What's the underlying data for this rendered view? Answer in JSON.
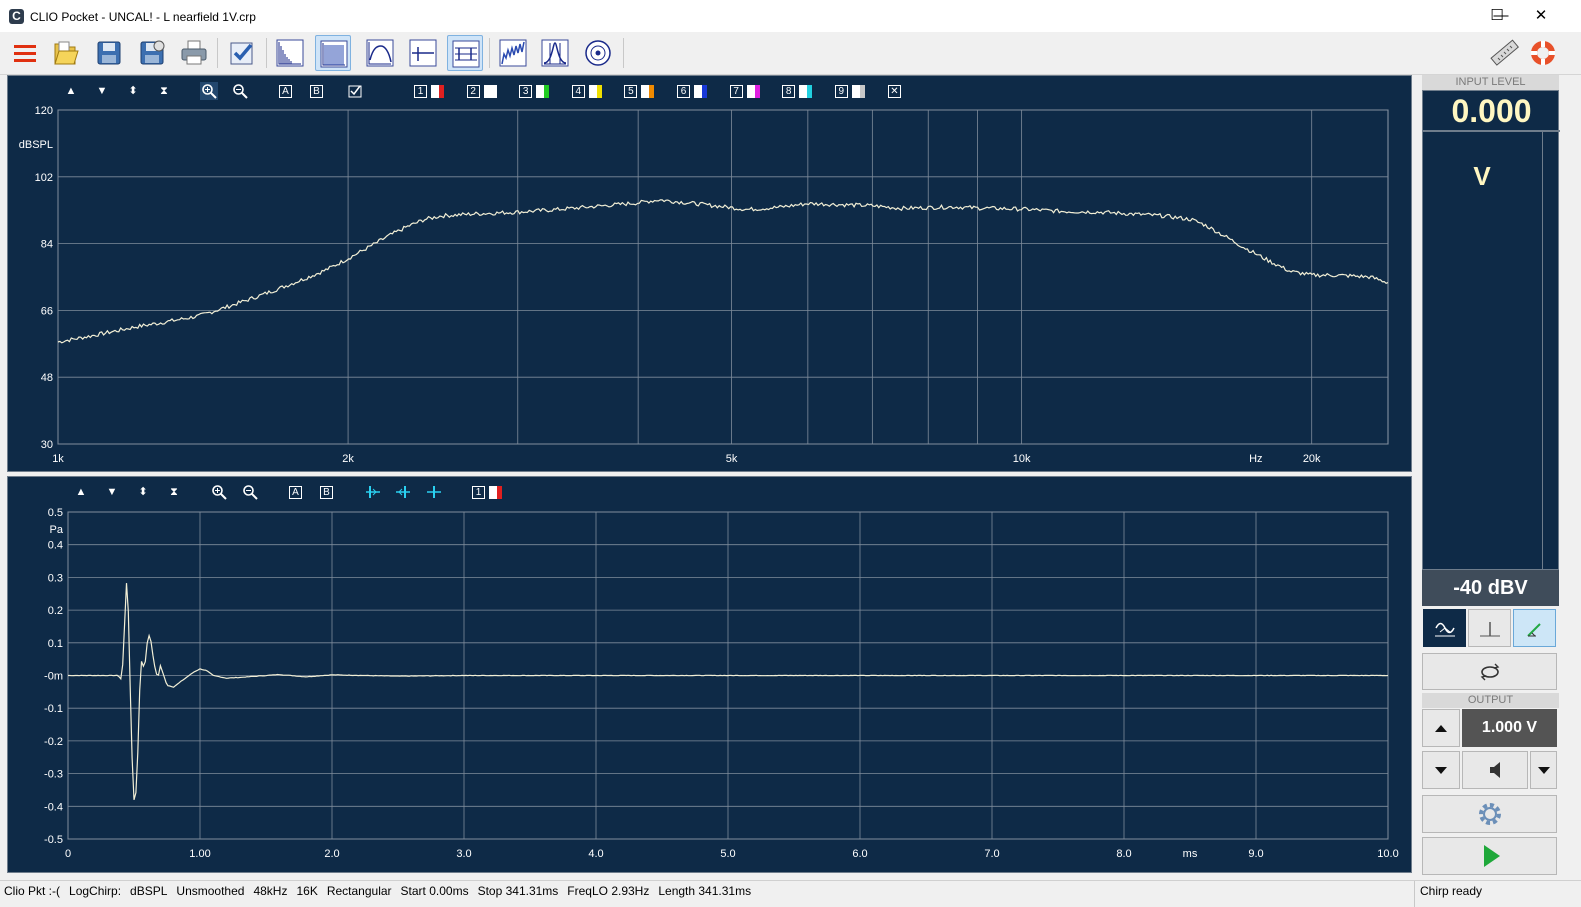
{
  "window": {
    "title": "CLIO Pocket - UNCAL! - L nearfield 1V.crp",
    "logo_letter": "C",
    "minimize": "—",
    "maximize": "☐",
    "close": "✕"
  },
  "toolbar": {
    "buttons": [
      {
        "name": "menu",
        "icon": "hamburger-icon",
        "active": false
      },
      {
        "name": "open",
        "icon": "open-folder-icon",
        "active": false
      },
      {
        "name": "save",
        "icon": "save-icon",
        "active": false
      },
      {
        "name": "save-as",
        "icon": "save-as-icon",
        "active": false
      },
      {
        "name": "print",
        "icon": "printer-icon",
        "active": false
      },
      {
        "name": "calibration",
        "icon": "checkbox-icon",
        "active": false
      },
      {
        "name": "fft",
        "icon": "fft-icon",
        "active": false
      },
      {
        "name": "mls",
        "icon": "mls-icon",
        "active": true
      },
      {
        "name": "sinusoidal",
        "icon": "sinusoidal-icon",
        "active": false
      },
      {
        "name": "waterfall",
        "icon": "waterfall-icon",
        "active": false
      },
      {
        "name": "impulse",
        "icon": "impulse-icon",
        "active": true
      },
      {
        "name": "spectrum",
        "icon": "spectrum-icon",
        "active": false
      },
      {
        "name": "thd",
        "icon": "thd-icon",
        "active": false
      },
      {
        "name": "polar",
        "icon": "polar-icon",
        "active": false
      },
      {
        "name": "ruler",
        "icon": "ruler-icon",
        "active": false
      },
      {
        "name": "help",
        "icon": "lifebuoy-icon",
        "active": false
      }
    ]
  },
  "top_panel": {
    "toolbar": {
      "buttons": [
        "▲",
        "▼",
        "⬍",
        "⧗"
      ],
      "marker_a": "A",
      "marker_b": "B",
      "overlays": [
        {
          "label": "1",
          "color": "#e02020"
        },
        {
          "label": "2",
          "color": "#ffffff"
        },
        {
          "label": "3",
          "color": "#22cc22"
        },
        {
          "label": "4",
          "color": "#f0e000"
        },
        {
          "label": "5",
          "color": "#f08a00"
        },
        {
          "label": "6",
          "color": "#1838d8"
        },
        {
          "label": "7",
          "color": "#e020e0"
        },
        {
          "label": "8",
          "color": "#22d0e0"
        },
        {
          "label": "9",
          "color": "#c8c8c8"
        }
      ],
      "clear": "✕"
    }
  },
  "bottom_panel": {
    "toolbar": {
      "buttons": [
        "▲",
        "▼",
        "⬍",
        "⧗"
      ],
      "marker_a": "A",
      "marker_b": "B",
      "overlays": [
        {
          "label": "1",
          "color": "#e02020"
        }
      ]
    }
  },
  "chart_data": [
    {
      "type": "line",
      "title": "",
      "xscale": "log",
      "xlim": [
        1000,
        24000
      ],
      "ylim": [
        30,
        120
      ],
      "ylabel": "dBSPL",
      "xlabel": "Hz",
      "yticks": [
        30,
        48,
        66,
        84,
        102,
        120
      ],
      "yticklabels": [
        "30",
        "48",
        "66",
        "84",
        "102",
        "120"
      ],
      "xticks": [
        1000,
        2000,
        5000,
        10000,
        20000
      ],
      "xticklabels": [
        "1k",
        "2k",
        "5k",
        "10k",
        "20k"
      ],
      "xgrid": [
        1000,
        2000,
        3000,
        4000,
        5000,
        6000,
        7000,
        8000,
        9000,
        10000,
        20000
      ],
      "xlabel_at": 17500,
      "grid": true,
      "line_color": "#f2efd6",
      "series": [
        {
          "x": [
            1000,
            1100,
            1200,
            1300,
            1400,
            1500,
            1600,
            1700,
            1800,
            1900,
            2000,
            2100,
            2200,
            2300,
            2400,
            2500,
            2700,
            3000,
            3300,
            3600,
            4000,
            4200,
            4500,
            4800,
            5200,
            5600,
            6000,
            6500,
            7000,
            7500,
            8000,
            8500,
            9000,
            10000,
            11000,
            12000,
            13000,
            14000,
            15000,
            15500,
            16000,
            17000,
            18000,
            19000,
            20000,
            21000,
            22000,
            23000,
            24000
          ],
          "y": [
            57.5,
            59.5,
            61.5,
            63,
            64.5,
            67,
            69.5,
            72,
            74.5,
            77,
            80,
            83,
            86,
            88.5,
            90.5,
            91.5,
            92,
            92.5,
            93.2,
            94,
            95,
            95.8,
            95,
            94.2,
            93.2,
            93.8,
            94.8,
            94.5,
            94.2,
            93.5,
            93.7,
            93.9,
            93.6,
            93.3,
            92.7,
            92.5,
            92,
            91.5,
            90.5,
            89,
            87,
            83,
            79.5,
            76.5,
            75.5,
            75.5,
            75.3,
            75,
            73.5
          ]
        }
      ]
    },
    {
      "type": "line",
      "title": "",
      "xlim": [
        0,
        10
      ],
      "ylim": [
        -0.5,
        0.5
      ],
      "ylabel": "Pa",
      "xlabel": "ms",
      "yticks": [
        -0.5,
        -0.4,
        -0.3,
        -0.2,
        -0.1,
        0,
        0.1,
        0.2,
        0.3,
        0.4,
        0.5
      ],
      "yticklabels": [
        "-0.5",
        "-0.4",
        "-0.3",
        "-0.2",
        "-0.1",
        "-0m",
        "0.1",
        "0.2",
        "0.3",
        "0.4",
        "0.5"
      ],
      "xticks": [
        0,
        1,
        2,
        3,
        4,
        5,
        6,
        7,
        8,
        9,
        10
      ],
      "xticklabels": [
        "0",
        "1.00",
        "2.0",
        "3.0",
        "4.0",
        "5.0",
        "6.0",
        "7.0",
        "8.0",
        "9.0",
        "10.0"
      ],
      "xlabel_at": 8.5,
      "grid": true,
      "line_color": "#f2efd6",
      "series": [
        {
          "x": [
            0,
            0.3,
            0.38,
            0.4,
            0.42,
            0.44,
            0.46,
            0.48,
            0.5,
            0.52,
            0.55,
            0.58,
            0.6,
            0.62,
            0.65,
            0.68,
            0.7,
            0.75,
            0.8,
            0.85,
            0.9,
            0.95,
            1.0,
            1.05,
            1.1,
            1.2,
            1.3,
            1.4,
            1.6,
            1.8,
            2.0,
            2.5,
            3.0,
            4.0,
            5.0,
            6.0,
            7.0,
            8.0,
            9.0,
            10.0
          ],
          "y": [
            0,
            0,
            0,
            -0.01,
            0.05,
            0.3,
            0.18,
            -0.2,
            -0.38,
            -0.35,
            0.05,
            0.02,
            0.1,
            0.13,
            0.04,
            -0.01,
            0.03,
            -0.03,
            -0.035,
            -0.02,
            -0.005,
            0.01,
            0.02,
            0.015,
            0,
            -0.008,
            -0.006,
            -0.003,
            0.003,
            -0.004,
            0.002,
            -0.002,
            0,
            0,
            0,
            0,
            0,
            0,
            0,
            0
          ]
        }
      ]
    }
  ],
  "input_level": {
    "header": "INPUT LEVEL",
    "value": "0.000",
    "unit": "V",
    "range": "-40 dBV"
  },
  "output": {
    "header": "OUTPUT",
    "value": "1.000 V"
  },
  "status": {
    "left": [
      "Clio Pkt :-(",
      "LogChirp:",
      "dBSPL",
      "Unsmoothed",
      "48kHz",
      "16K",
      "Rectangular",
      "Start 0.00ms",
      "Stop 341.31ms",
      "FreqLO 2.93Hz",
      "Length 341.31ms"
    ],
    "right": "Chirp ready"
  }
}
